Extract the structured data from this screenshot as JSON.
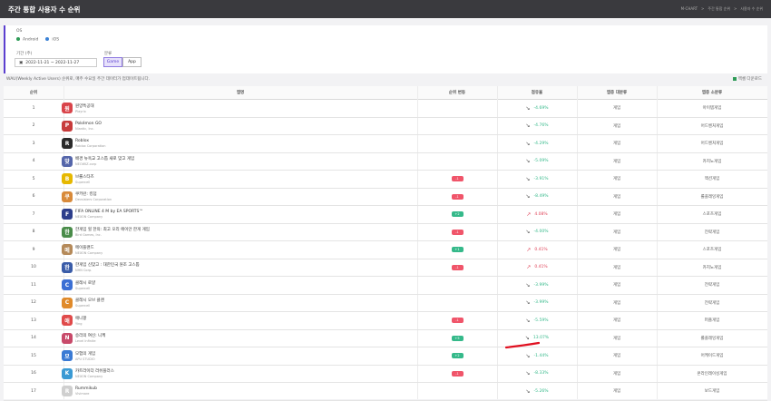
{
  "header": {
    "title": "주간 통합 사용자 수 순위",
    "breadcrumbs": [
      "M-CHART",
      "주간 통합 순위",
      "사용자 수 순위"
    ]
  },
  "filters": {
    "os_label": "OS",
    "os_options": [
      {
        "label": "Android",
        "color": "#2e9b57"
      },
      {
        "label": "iOS",
        "color": "#3b82d6"
      }
    ],
    "period_label": "기간 (주)",
    "period_value": "2022-11-21 ~ 2022-11-27",
    "category_label": "분류",
    "category_options": [
      {
        "label": "Game",
        "active": true
      },
      {
        "label": "App",
        "active": false
      }
    ]
  },
  "note": "WAU(Weekly Active Users) 순위로, 매주 수요일 주간 데이터가 업데이트됩니다.",
  "export_label": "엑셀 다운로드",
  "columns": [
    "순위",
    "앱명",
    "순위 변동",
    "점유율",
    "앱종 대분류",
    "앱종 소분류"
  ],
  "rows": [
    {
      "rank": "1",
      "name": "원양특공대",
      "company": "Playrix",
      "change": "",
      "share": "-4.69%",
      "trend": "down",
      "major": "게임",
      "minor": "아이템게임",
      "icon_color": "#d9444a",
      "icon_text": "원"
    },
    {
      "rank": "2",
      "name": "Pokémon GO",
      "company": "Niantic, Inc.",
      "change": "",
      "share": "-4.76%",
      "trend": "down",
      "major": "게임",
      "minor": "어드벤처게임",
      "icon_color": "#c73a3a",
      "icon_text": "P"
    },
    {
      "rank": "3",
      "name": "Roblox",
      "company": "Roblox Corporation",
      "change": "",
      "share": "-4.29%",
      "trend": "down",
      "major": "게임",
      "minor": "어드벤처게임",
      "icon_color": "#2a2a2a",
      "icon_text": "R"
    },
    {
      "rank": "4",
      "name": "배경 뉴욕교 고스톱 새로 맞고 게임",
      "company": "NEOWIZ.corp",
      "change": "",
      "share": "-5.09%",
      "trend": "down",
      "major": "게임",
      "minor": "카지노게임",
      "icon_color": "#5566aa",
      "icon_text": "맞"
    },
    {
      "rank": "5",
      "name": "브롤스타즈",
      "company": "Supercell",
      "change": "-1",
      "share": "-3.91%",
      "trend": "down",
      "major": "게임",
      "minor": "액션게임",
      "icon_color": "#e6b800",
      "icon_text": "B"
    },
    {
      "rank": "6",
      "name": "쿠키런: 킹덤",
      "company": "Devsisters Corporation",
      "change": "-1",
      "share": "-8.49%",
      "trend": "down",
      "major": "게임",
      "minor": "롤플레잉게임",
      "icon_color": "#d88a3a",
      "icon_text": "쿠"
    },
    {
      "rank": "7",
      "name": "FIFA ONLINE 4 M by EA SPORTS™",
      "company": "NEXON Company",
      "change": "+2",
      "share": "4.08%",
      "trend": "up",
      "major": "게임",
      "minor": "스포츠게임",
      "icon_color": "#2d3e8c",
      "icon_text": "F"
    },
    {
      "rank": "8",
      "name": "한게임 힐 한의: 최고 오리 에이안 한게 게임",
      "company": "Bird Games, Inc.",
      "change": "-1",
      "share": "-4.00%",
      "trend": "down",
      "major": "게임",
      "minor": "전략게임",
      "icon_color": "#4a8c4a",
      "icon_text": "한"
    },
    {
      "rank": "9",
      "name": "메이플랜드",
      "company": "NEXON Company",
      "change": "+1",
      "share": "0.41%",
      "trend": "up",
      "major": "게임",
      "minor": "스포츠게임",
      "icon_color": "#b58a5a",
      "icon_text": "메"
    },
    {
      "rank": "10",
      "name": "한게임 신맞고 : 대한민국 원조 고스톱",
      "company": "NHN Corp.",
      "change": "-1",
      "share": "0.41%",
      "trend": "up",
      "major": "게임",
      "minor": "카지노게임",
      "icon_color": "#3a5ca8",
      "icon_text": "한"
    },
    {
      "rank": "11",
      "name": "클래시 로얄",
      "company": "Supercell",
      "change": "",
      "share": "-3.99%",
      "trend": "down",
      "major": "게임",
      "minor": "전략게임",
      "icon_color": "#3b6fd4",
      "icon_text": "C"
    },
    {
      "rank": "12",
      "name": "클래시 오브 클랜",
      "company": "Supercell",
      "change": "",
      "share": "-3.99%",
      "trend": "down",
      "major": "게임",
      "minor": "전략게임",
      "icon_color": "#e08a2a",
      "icon_text": "C"
    },
    {
      "rank": "13",
      "name": "애니팡",
      "company": "Ying",
      "change": "-1",
      "share": "-5.59%",
      "trend": "down",
      "major": "게임",
      "minor": "퍼즐게임",
      "icon_color": "#e04a4a",
      "icon_text": "애"
    },
    {
      "rank": "14",
      "name": "승리의 여신: 니케",
      "company": "Level Infinite",
      "change": "+5",
      "share": "13.07%",
      "trend": "down",
      "major": "게임",
      "minor": "롤플레잉게임",
      "icon_color": "#c84a6a",
      "icon_text": "N"
    },
    {
      "rank": "15",
      "name": "모험의 게임",
      "company": "APU STUDIO",
      "change": "+2",
      "share": "-1.44%",
      "trend": "down",
      "major": "게임",
      "minor": "어케이드게임",
      "icon_color": "#3a7ad4",
      "icon_text": "모"
    },
    {
      "rank": "16",
      "name": "카트라이더 러쉬플러스",
      "company": "NEXON Company",
      "change": "-1",
      "share": "-8.33%",
      "trend": "down",
      "major": "게임",
      "minor": "온라인레이싱게임",
      "icon_color": "#3a9ad4",
      "icon_text": "K"
    },
    {
      "rank": "17",
      "name": "Rummikub",
      "company": "Vivimare",
      "change": "",
      "share": "-5.26%",
      "trend": "down",
      "major": "게임",
      "minor": "보드게임",
      "icon_color": "#cfcfcf",
      "icon_text": "R"
    }
  ]
}
